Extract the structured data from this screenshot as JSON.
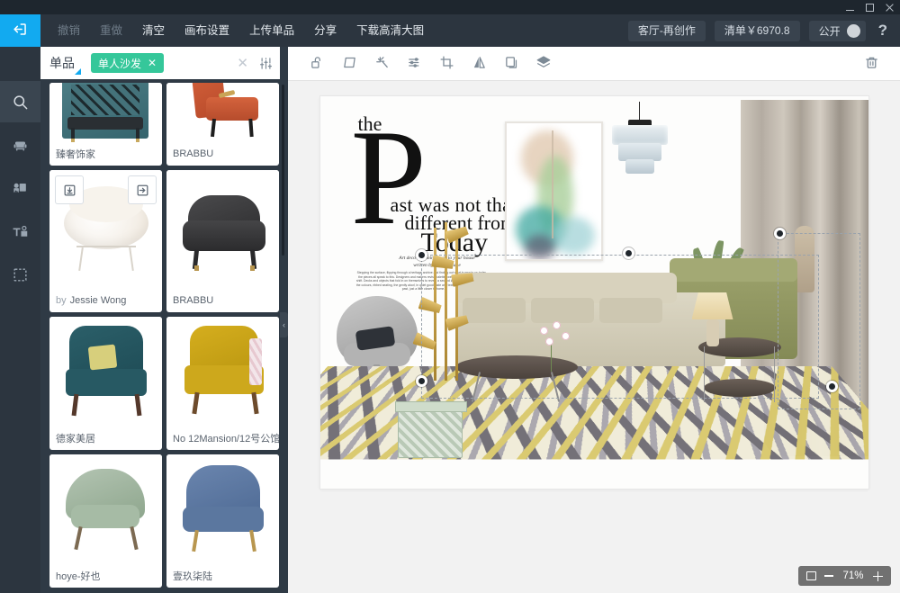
{
  "window": {
    "minimize_label": "minimize",
    "maximize_label": "maximize",
    "close_label": "close"
  },
  "topbar": {
    "logo_icon": "exit-arrow-icon",
    "menu": [
      {
        "label": "撤销",
        "enabled": false
      },
      {
        "label": "重做",
        "enabled": false
      },
      {
        "label": "清空",
        "enabled": true
      },
      {
        "label": "画布设置",
        "enabled": true
      },
      {
        "label": "上传单品",
        "enabled": true
      },
      {
        "label": "分享",
        "enabled": true
      },
      {
        "label": "下载高清大图",
        "enabled": true
      }
    ],
    "project_pill": "客厅-再创作",
    "list_pill": "清单￥6970.8",
    "visibility_label": "公开",
    "help_label": "?"
  },
  "rail": {
    "items": [
      {
        "name": "search",
        "icon": "search-icon",
        "active": true
      },
      {
        "name": "furniture",
        "icon": "armchair-icon",
        "active": false
      },
      {
        "name": "scene",
        "icon": "image-icon",
        "active": false
      },
      {
        "name": "text",
        "icon": "text-texture-icon",
        "active": false
      },
      {
        "name": "selection",
        "icon": "marquee-icon",
        "active": false
      }
    ]
  },
  "panel": {
    "tab_label": "单品",
    "filter_tag": "单人沙发",
    "filter_tag_close": "✕",
    "clear_label": "✕",
    "settings_icon": "sliders-icon",
    "card_action_download": "download-icon",
    "card_action_insert": "insert-icon",
    "products": [
      {
        "brand": "臻奢饰家",
        "by": ""
      },
      {
        "brand": "BRABBU",
        "by": ""
      },
      {
        "brand": "Jessie Wong",
        "by": "by"
      },
      {
        "brand": "BRABBU",
        "by": ""
      },
      {
        "brand": "德家美居",
        "by": ""
      },
      {
        "brand": "No 12Mansion/12号公馆",
        "by": ""
      },
      {
        "brand": "hoye-好也",
        "by": ""
      },
      {
        "brand": "壹玖柒陆",
        "by": ""
      }
    ],
    "collapse_icon": "chevron-left-icon"
  },
  "canvas_toolbar": {
    "tools": [
      {
        "name": "lock",
        "icon": "unlock-icon"
      },
      {
        "name": "transform",
        "icon": "perspective-icon"
      },
      {
        "name": "magic",
        "icon": "magic-wand-icon"
      },
      {
        "name": "adjust",
        "icon": "sliders-icon"
      },
      {
        "name": "crop",
        "icon": "crop-icon"
      },
      {
        "name": "flip",
        "icon": "flip-icon"
      },
      {
        "name": "duplicate",
        "icon": "copy-icon"
      },
      {
        "name": "layers",
        "icon": "layers-icon"
      }
    ],
    "delete_icon": "trash-icon"
  },
  "artwork": {
    "headline_the": "the",
    "headline_P": "P",
    "line1": "ast was not that",
    "line2": "different from",
    "line3": "Today",
    "subtitle": "Art deco is coming back to your house<br>written by: Amelia Jane",
    "body": "Stepping the surface, flipping through a heritage archive and finding out what is new to us today — the pieces all speak to this. Designers and makers revisit palettes we only seem to get, it is not a shift. Decks and objects that fold in on themselves to reveal a second layer, hand-tied pockets bend the colours, ribbed seating, the gently aloof, in quiet good taste and texture that quietly relays a little past, just a little closer to home."
  },
  "zoom": {
    "fit_icon": "fit-screen-icon",
    "minus": "−",
    "value": "71%",
    "plus": "+"
  }
}
